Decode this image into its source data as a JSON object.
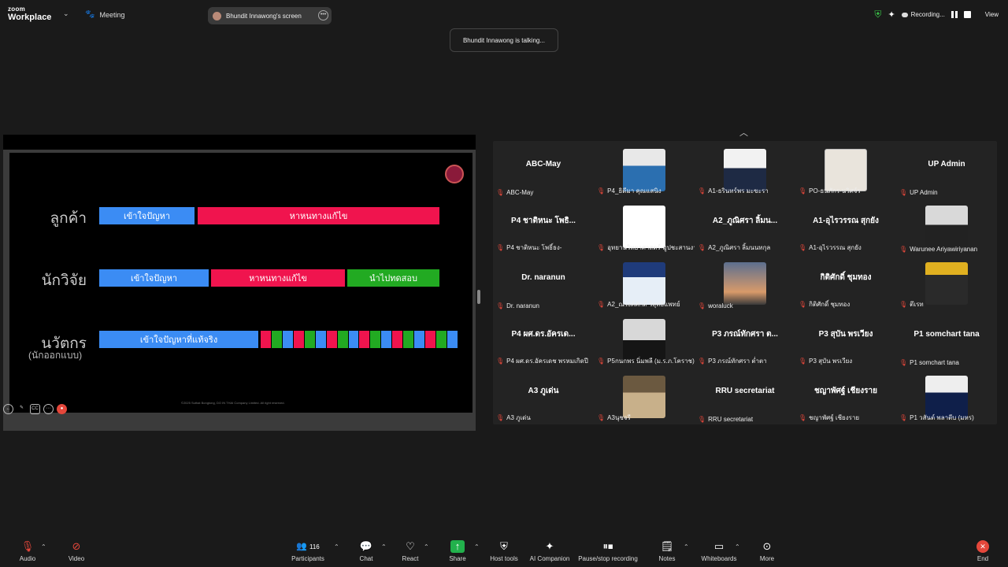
{
  "app": {
    "logo_line1": "zoom",
    "logo_line2": "Workplace"
  },
  "topbar": {
    "meeting_label": "Meeting",
    "screen_pill": "Bhundit Innawong's screen",
    "recording_label": "Recording...",
    "view_label": "View"
  },
  "talking_indicator": "Bhundit Innawong is talking...",
  "slide": {
    "rows": [
      {
        "label": "ลูกค้า",
        "boxes": [
          "เข้าใจปัญหา",
          "หาหนทางแก้ไข"
        ]
      },
      {
        "label": "นักวิจัย",
        "boxes": [
          "เข้าใจปัญหา",
          "หาหนทางแก้ไข",
          "นำไปทดสอบ"
        ]
      },
      {
        "label": "นวัตกร",
        "sub": "(นักออกแบบ)",
        "boxes": [
          "เข้าใจปัญหาที่แท้จริง"
        ]
      }
    ],
    "copyright": "©2025 Suthat Bongtong, DO IN THAI Company Limited. All right reserved.",
    "logo_text": "DO IN THAI"
  },
  "gallery": {
    "tiles": [
      {
        "name": "ABC-May",
        "caption": "ABC-May"
      },
      {
        "name": "",
        "caption": "P4_ธิดีมา คุณแสนิง",
        "photo": "woman-blue"
      },
      {
        "name": "",
        "caption": "A1-ธรินทร์พร มะขะรา",
        "photo": "woman-navy"
      },
      {
        "name": "",
        "caption": "PO-ธนภักร-นวิศจ์ร",
        "photo": "logo-crest"
      },
      {
        "name": "UP Admin",
        "caption": "UP Admin"
      },
      {
        "name": "P4 ชาติหนะ โพธิ...",
        "caption": "P4 ชาติหนะ โพธิ์ธง-"
      },
      {
        "name": "",
        "caption": "อุทยานวิทยาศาสตร์-มูปชะสานงาน",
        "photo": "logo-sptp"
      },
      {
        "name": "A2_ภูณิศรา ลิ้มน...",
        "caption": "A2_ภูณิศรา ลิ้มนนทกุล"
      },
      {
        "name": "A1-อุไรวรรณ สุกยัง",
        "caption": "A1-อุไรวรรณ สุกยัง"
      },
      {
        "name": "",
        "caption": "Warunee Ariyawiriyanan",
        "photo": "woman-white"
      },
      {
        "name": "Dr. naranun",
        "caption": "Dr. naranun"
      },
      {
        "name": "",
        "caption": "A2_ณรงค์ศักดิ์ วิสุทธิแพทย์",
        "photo": "poster-man"
      },
      {
        "name": "",
        "caption": "woraluck",
        "photo": "sky"
      },
      {
        "name": "กิติศักดิ์ ชุมทอง",
        "caption": "กิติศักดิ์ ชุมทอง"
      },
      {
        "name": "",
        "caption": "ตึเรท",
        "photo": "man-yellow"
      },
      {
        "name": "P4 ผศ.ดร.อัครเด...",
        "caption": "P4 ผศ.ดร.อัครเดช พรหมเกิดปี"
      },
      {
        "name": "",
        "caption": "P5กนกพร นิ่มพลี (ม.ร.ภ.โคราช)",
        "photo": "woman-black"
      },
      {
        "name": "P3 ภรณ์ทักศรา ต...",
        "caption": "P3 ภรณ์ทักศรา ต่ำตา"
      },
      {
        "name": "P3 สุบัน พรเวียง",
        "caption": "P3 สุบัน พรเวียง"
      },
      {
        "name": "P1 somchart tana",
        "caption": "P1 somchart tana"
      },
      {
        "name": "A3 ภูเด่น",
        "caption": "A3 ภูเด่น"
      },
      {
        "name": "",
        "caption": "A3นุชจรี",
        "photo": "woman-table"
      },
      {
        "name": "RRU secretariat",
        "caption": "RRU secretariat"
      },
      {
        "name": "ชญาพัศฐ์ เชียงราย",
        "caption": "ชญาพัศฐ์ เชียงราย"
      },
      {
        "name": "",
        "caption": "P1 วสันต์ พลาตีบ (มหร)",
        "photo": "man-suit"
      }
    ]
  },
  "bottombar": {
    "audio": "Audio",
    "video": "Video",
    "participants": "Participants",
    "participants_count": "116",
    "chat": "Chat",
    "react": "React",
    "share": "Share",
    "host_tools": "Host tools",
    "ai_companion": "AI Companion",
    "pause_recording": "Pause/stop recording",
    "notes": "Notes",
    "whiteboards": "Whiteboards",
    "more": "More",
    "end": "End"
  },
  "colors": {
    "mute": "#e5473b",
    "share_green": "#22b14c",
    "slide_blue": "#3b8cf4",
    "slide_pink": "#f0144e",
    "slide_green": "#22aa22"
  }
}
